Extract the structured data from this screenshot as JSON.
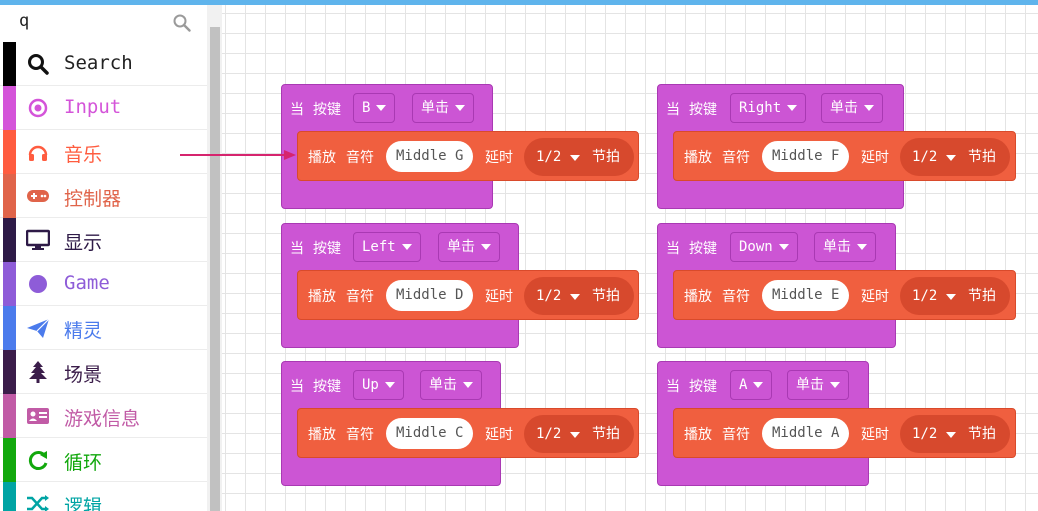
{
  "search": {
    "value": "q"
  },
  "categories": [
    {
      "label": "Search",
      "color": "#000000",
      "text_color": "#222222",
      "icon": "search-icon"
    },
    {
      "label": "Input",
      "color": "#d454d9",
      "text_color": "#d454d9",
      "icon": "input-icon"
    },
    {
      "label": "音乐",
      "color": "#ff5c3f",
      "text_color": "#ff5c3f",
      "icon": "headphones-icon"
    },
    {
      "label": "控制器",
      "color": "#e0644a",
      "text_color": "#e0644a",
      "icon": "gamepad-icon"
    },
    {
      "label": "显示",
      "color": "#2e1a47",
      "text_color": "#2e1a47",
      "icon": "monitor-icon"
    },
    {
      "label": "Game",
      "color": "#8e5cd8",
      "text_color": "#8e5cd8",
      "icon": "circle-icon"
    },
    {
      "label": "精灵",
      "color": "#4b7bec",
      "text_color": "#4b7bec",
      "icon": "paper-plane-icon"
    },
    {
      "label": "场景",
      "color": "#3b1d4a",
      "text_color": "#3b1d4a",
      "icon": "tree-icon"
    },
    {
      "label": "游戏信息",
      "color": "#c15ba6",
      "text_color": "#c15ba6",
      "icon": "id-card-icon"
    },
    {
      "label": "循环",
      "color": "#12a80d",
      "text_color": "#12a80d",
      "icon": "refresh-icon"
    },
    {
      "label": "逻辑",
      "color": "#00a4a4",
      "text_color": "#00a4a4",
      "icon": "shuffle-icon"
    }
  ],
  "blocks": {
    "when_label": "当",
    "button_label": "按键",
    "play_label": "播放",
    "note_label": "音符",
    "delay_label": "延时",
    "beat_unit": "节拍",
    "items": [
      {
        "key": "B",
        "action": "单击",
        "note": "Middle G",
        "beat": "1/2"
      },
      {
        "key": "Right",
        "action": "单击",
        "note": "Middle F",
        "beat": "1/2"
      },
      {
        "key": "Left",
        "action": "单击",
        "note": "Middle D",
        "beat": "1/2"
      },
      {
        "key": "Down",
        "action": "单击",
        "note": "Middle E",
        "beat": "1/2"
      },
      {
        "key": "Up",
        "action": "单击",
        "note": "Middle C",
        "beat": "1/2"
      },
      {
        "key": "A",
        "action": "单击",
        "note": "Middle A",
        "beat": "1/2"
      }
    ]
  }
}
